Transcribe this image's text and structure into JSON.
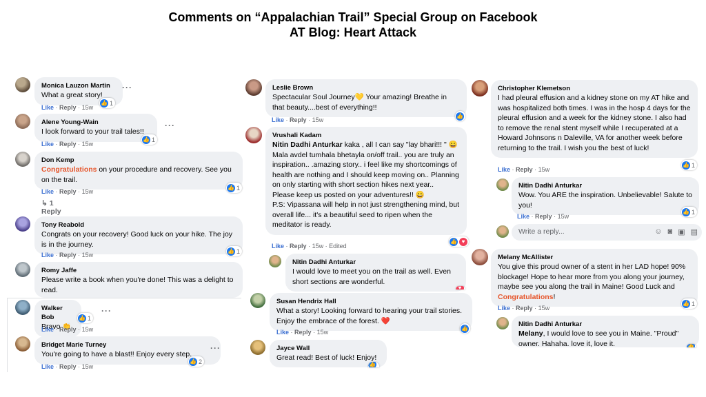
{
  "header": {
    "line1": "Comments on “Appalachian Trail” Special Group on Facebook",
    "line2": "AT Blog: Heart Attack"
  },
  "labels": {
    "like": "Like",
    "reply": "Reply",
    "dot": "·",
    "edited": "Edited",
    "write_reply": "Write a reply..."
  },
  "col1": {
    "monica": {
      "name": "Monica Lauzon Martin",
      "text": "What a great story!",
      "time": "15w",
      "count": "1"
    },
    "alene": {
      "name": "Alene Young-Wain",
      "text": "I look forward to your trail tales!!",
      "time": "15w",
      "count": "1"
    },
    "don": {
      "name": "Don Kemp",
      "hl": "Congratulations",
      "text": " on your procedure and recovery. See you on the trail.",
      "time": "15w",
      "count": "1",
      "replies": "1 Reply"
    },
    "tony": {
      "name": "Tony Reabold",
      "text": "Congrats on your recovery! Good luck on your hike. The joy is in the journey.",
      "time": "15w",
      "count": "1"
    },
    "romy": {
      "name": "Romy Jaffe",
      "text": "Please write a book when you're done! This was a delight to read."
    },
    "walker": {
      "name": "Walker Bob",
      "text": "Bravo 👏",
      "time": "15w",
      "count": "1"
    },
    "bridget": {
      "name": "Bridget Marie Turney",
      "text": "You're going to have a blast!! Enjoy every step.",
      "time": "15w",
      "count": "2"
    }
  },
  "col2": {
    "leslie": {
      "name": "Leslie Brown",
      "text": "Spectacular Soul Journey💛 Your amazing! Breathe in that beauty....best of everything!!",
      "time": "15w"
    },
    "vrushali": {
      "name": "Vrushali Kadam",
      "mention": "Nitin Dadhi Anturkar",
      "line1": " kaka , all I can say \"lay bhari!!! \" 😀",
      "text": "Mala avdel tumhala bhetayla on/off trail.. you are truly an inspiration.. .amazing story.. i feel like my shortcomings of health are nothing and I should keep moving on.. Planning on only starting with short section hikes next year..",
      "text2": "Please keep us posted on your adventures!! 😀",
      "text3": "P.S: Vipassana will help in not just strengthening mind, but overall life... it's a beautiful seed to ripen when the meditator is ready.",
      "time": "15w"
    },
    "nitin1": {
      "name": "Nitin Dadhi Anturkar",
      "text": "I would love to meet you on the trail as well. Even short sections are wonderful."
    },
    "susan": {
      "name": "Susan Hendrix Hall",
      "text": "What a story! Looking forward to hearing your trail stories. Enjoy the embrace of the forest. ❤️",
      "time": "15w"
    },
    "jayce": {
      "name": "Jayce Wall",
      "text": "Great read! Best of luck! Enjoy!"
    }
  },
  "col3": {
    "christopher": {
      "name": "Christopher Klemetson",
      "text": "I had pleural effusion and a kidney stone on my AT hike and was hospitalized both times. I was in the hosp 4 days for the pleural effusion and a week for the kidney stone. I also had to remove the renal stent myself while I recuperated at a Howard Johnsons n Daleville, VA for another week before returning to the trail. I wish you the best of luck!",
      "time": "15w",
      "count": "1"
    },
    "nitin2": {
      "name": "Nitin Dadhi Anturkar",
      "text": "Wow. You ARE the inspiration. Unbelievable! Salute to you!",
      "time": "15w",
      "count": "1"
    },
    "melany": {
      "name": "Melany McAllister",
      "text": "You give this proud owner of a stent in her LAD hope! 90% blockage! Hope to hear more from you along your journey, maybe see you along the trail in Maine! Good Luck and ",
      "hl": "Congratulations",
      "end": "!",
      "time": "15w",
      "count": "1"
    },
    "nitin3": {
      "name": "Nitin Dadhi Anturkar",
      "mention": "Melany",
      "text": ", I would love to see you in Maine. \"Proud\" owner. Hahaha. love it, love it."
    }
  }
}
